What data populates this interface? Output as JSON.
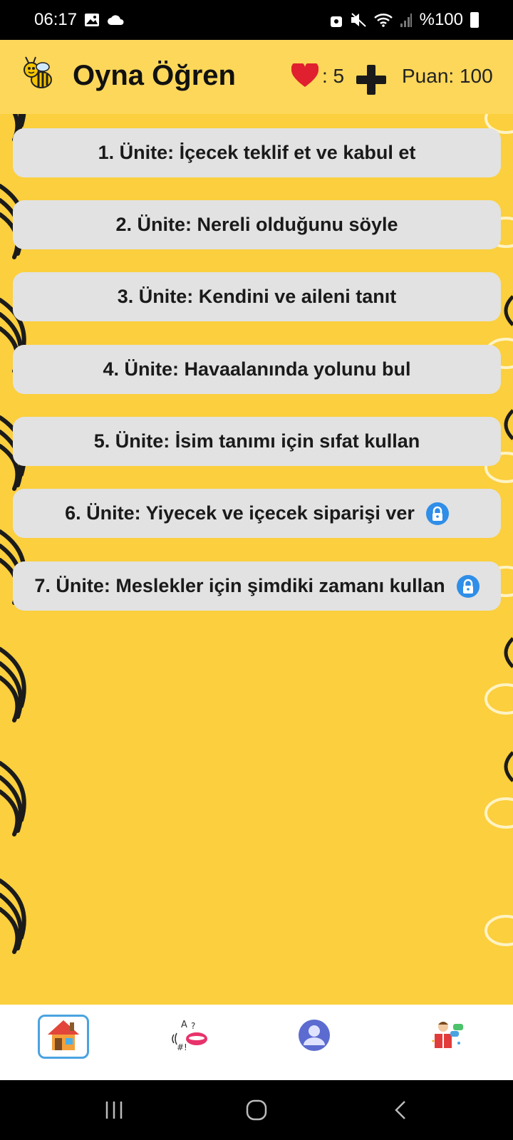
{
  "status_bar": {
    "time": "06:17",
    "battery_text": "%100",
    "icons": [
      "image-icon",
      "cloud-icon",
      "security-icon",
      "mute-icon",
      "wifi-icon",
      "signal-icon",
      "battery-icon"
    ]
  },
  "header": {
    "title": "Oyna Öğren",
    "lives_text": ": 5",
    "score_text": "Puan: 100",
    "icons": [
      "bee-logo-icon",
      "heart-icon",
      "plus-icon"
    ]
  },
  "units": [
    {
      "label": "1. Ünite: İçecek teklif et ve kabul et",
      "locked": false
    },
    {
      "label": "2. Ünite: Nereli olduğunu söyle",
      "locked": false
    },
    {
      "label": "3. Ünite: Kendini ve aileni tanıt",
      "locked": false
    },
    {
      "label": "4. Ünite: Havaalanında yolunu bul",
      "locked": false
    },
    {
      "label": "5. Ünite: İsim tanımı için sıfat kullan",
      "locked": false
    },
    {
      "label": "6. Ünite: Yiyecek ve içecek siparişi ver",
      "locked": true
    },
    {
      "label": "7. Ünite: Meslekler için şimdiki zamanı kullan",
      "locked": true
    }
  ],
  "bottom_nav": {
    "items": [
      {
        "name": "home",
        "icon": "home-icon",
        "active": true
      },
      {
        "name": "pronunciation",
        "icon": "speaking-icon",
        "active": false
      },
      {
        "name": "profile",
        "icon": "user-icon",
        "active": false
      },
      {
        "name": "learn",
        "icon": "book-learner-icon",
        "active": false
      }
    ]
  },
  "colors": {
    "background": "#fbcf3d",
    "header": "#fcd75a",
    "unit_card": "#e2e2e2",
    "lock_blue": "#2f8ee8",
    "active_nav_border": "#4aa3e0"
  }
}
